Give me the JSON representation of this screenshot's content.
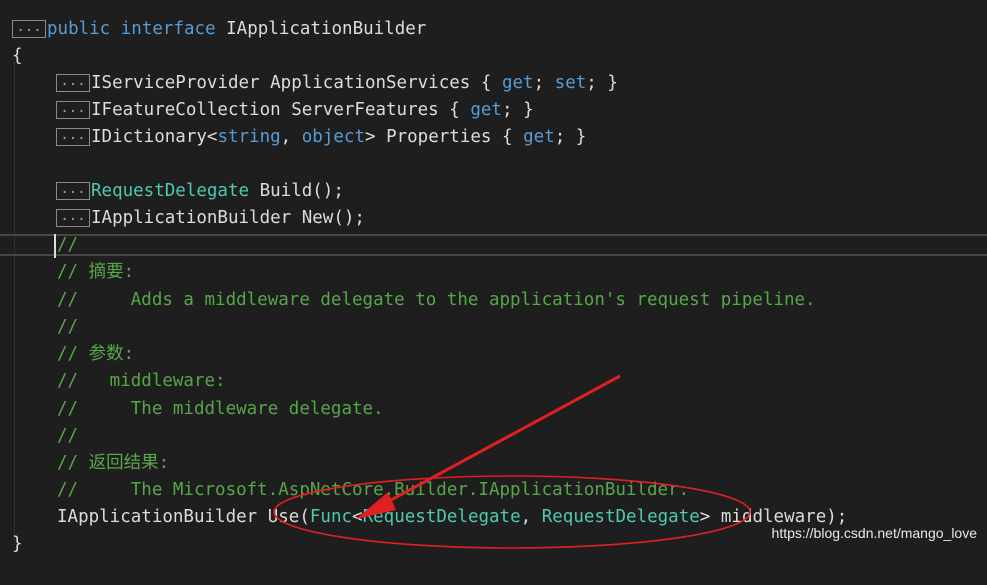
{
  "fold_marker": "...",
  "code": {
    "l1": {
      "kw1": "public",
      "kw2": "interface",
      "name": "IApplicationBuilder"
    },
    "l2": {
      "brace": "{"
    },
    "l3": {
      "type": "IServiceProvider",
      "name": "ApplicationServices",
      "open": "{",
      "get": "get",
      "semi1": ";",
      "set": "set",
      "semi2": ";",
      "close": "}"
    },
    "l4": {
      "type": "IFeatureCollection",
      "name": "ServerFeatures",
      "open": "{",
      "get": "get",
      "semi": ";",
      "close": "}"
    },
    "l5": {
      "type": "IDictionary",
      "lt": "<",
      "t1": "string",
      "comma": ",",
      "t2": "object",
      "gt": ">",
      "name": "Properties",
      "open": "{",
      "get": "get",
      "semi": ";",
      "close": "}"
    },
    "l7": {
      "type": "RequestDelegate",
      "rest": "Build();"
    },
    "l8": {
      "type": "IApplicationBuilder",
      "rest": "New();"
    },
    "l9": {
      "comment": "//"
    },
    "l10": {
      "comment": "// 摘要:"
    },
    "l11": {
      "comment": "//     Adds a middleware delegate to the application's request pipeline."
    },
    "l12": {
      "comment": "//"
    },
    "l13": {
      "comment": "// 参数:"
    },
    "l14": {
      "comment": "//   middleware:"
    },
    "l15": {
      "comment": "//     The middleware delegate."
    },
    "l16": {
      "comment": "//"
    },
    "l17": {
      "comment": "// 返回结果:"
    },
    "l18": {
      "comment": "//     The Microsoft.AspNetCore.Builder.IApplicationBuilder."
    },
    "l19": {
      "ret": "IApplicationBuilder",
      "method": "Use(",
      "func": "Func",
      "lt": "<",
      "p1": "RequestDelegate",
      "comma": ",",
      "p2": "RequestDelegate",
      "gt": ">",
      "param": "middleware);"
    },
    "l20": {
      "brace": "}"
    }
  },
  "watermark": "https://blog.csdn.net/mango_love",
  "colors": {
    "annotation": "#e02020",
    "keyword": "#569cd6",
    "type": "#4ec9b0",
    "comment": "#57a64a"
  }
}
